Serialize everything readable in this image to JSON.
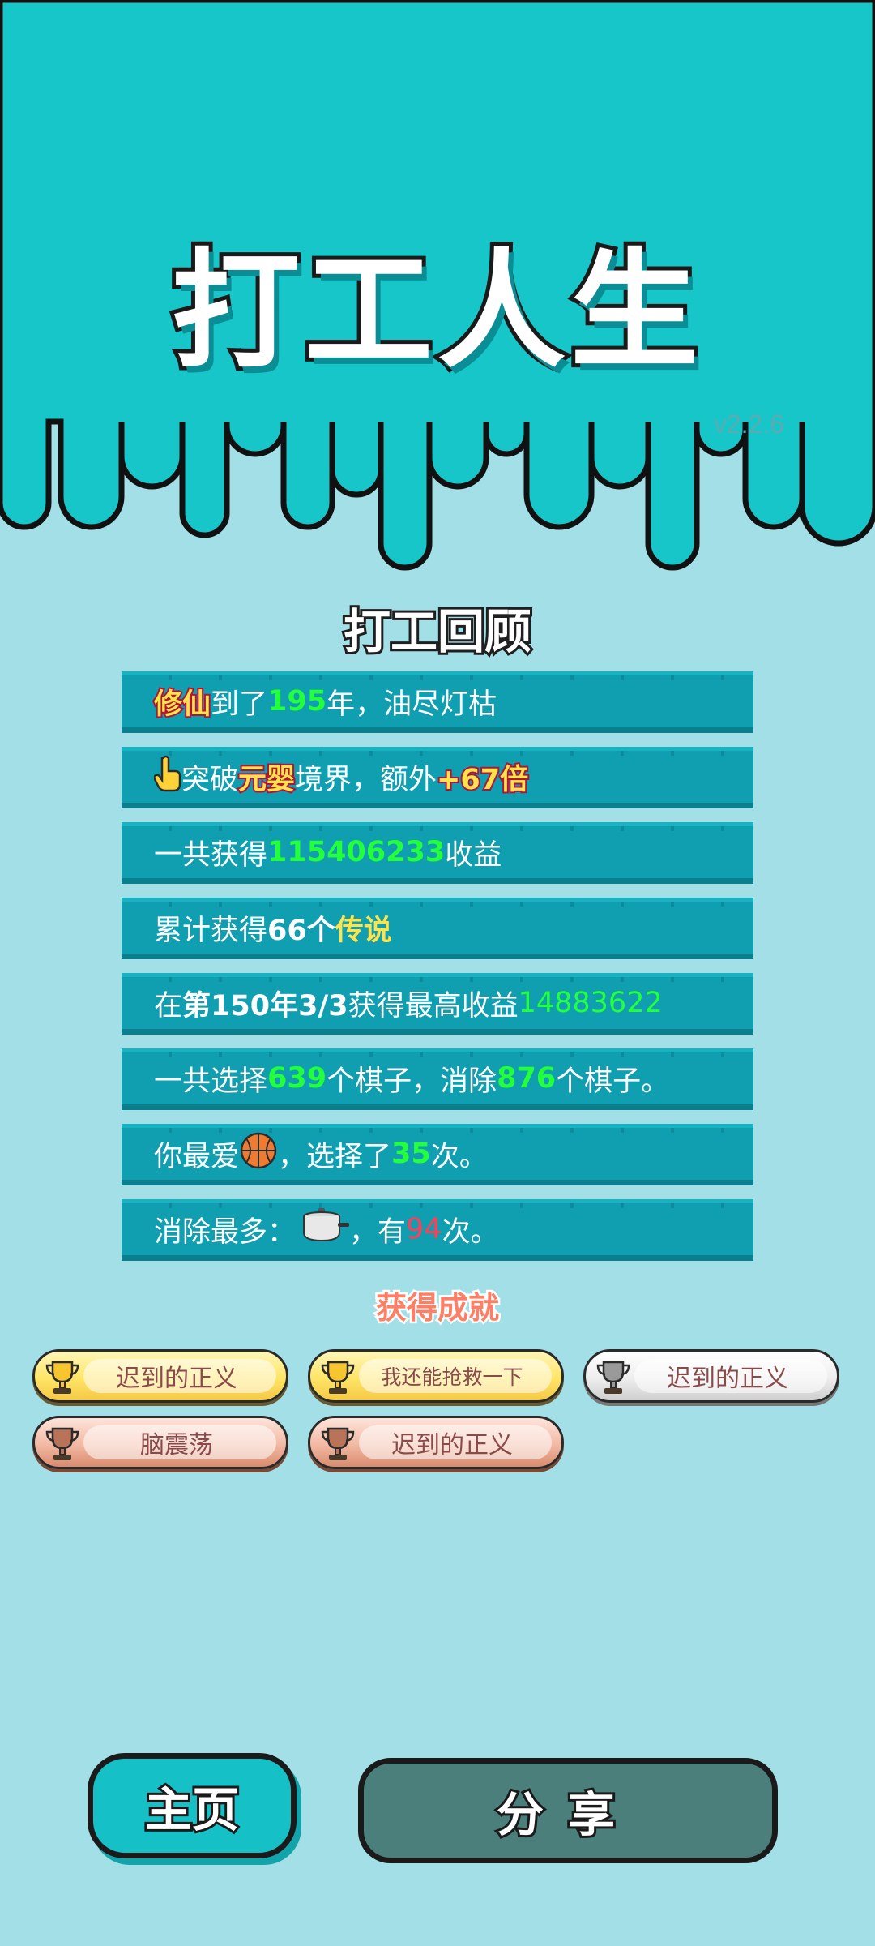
{
  "header": {
    "title": "打工人生",
    "version": "v2.2.6"
  },
  "review": {
    "title": "打工回顾",
    "rows": [
      {
        "parts": [
          {
            "t": "修仙",
            "c": "y"
          },
          {
            "t": "到了"
          },
          {
            "t": "195",
            "c": "g"
          },
          {
            "t": "年，油尽灯枯"
          }
        ]
      },
      {
        "icon": "pointing-hand-icon",
        "parts": [
          {
            "t": "突破"
          },
          {
            "t": "元婴",
            "c": "y"
          },
          {
            "t": "境界，额外"
          },
          {
            "t": "+67倍",
            "c": "y"
          }
        ]
      },
      {
        "parts": [
          {
            "t": "一共获得"
          },
          {
            "t": "115406233",
            "c": "g"
          },
          {
            "t": "收益"
          }
        ]
      },
      {
        "parts": [
          {
            "t": "累计获得"
          },
          {
            "t": "66个",
            "c": "b"
          },
          {
            "t": "传说",
            "c": "y2"
          }
        ]
      },
      {
        "parts": [
          {
            "t": "在 "
          },
          {
            "t": "第150年3/3",
            "c": "b"
          },
          {
            "t": " 获得最高收益"
          },
          {
            "t": "14883622",
            "c": "g2"
          }
        ]
      },
      {
        "parts": [
          {
            "t": "一共选择"
          },
          {
            "t": "639",
            "c": "g"
          },
          {
            "t": "个棋子，消除"
          },
          {
            "t": "876",
            "c": "g"
          },
          {
            "t": "个棋子。"
          }
        ]
      },
      {
        "parts": [
          {
            "t": "你最爱"
          },
          {
            "icon": "basketball-icon"
          },
          {
            "t": "，选择了"
          },
          {
            "t": "35",
            "c": "g"
          },
          {
            "t": "次。"
          }
        ]
      },
      {
        "parts": [
          {
            "t": "消除最多："
          },
          {
            "icon": "cooking-pot-icon"
          },
          {
            "t": "，有"
          },
          {
            "t": "94",
            "c": "r"
          },
          {
            "t": "次。"
          }
        ]
      }
    ]
  },
  "achievements": {
    "title": "获得成就",
    "items": [
      {
        "label": "迟到的正义",
        "tier": "gold"
      },
      {
        "label": "我还能抢救一下",
        "tier": "gold"
      },
      {
        "label": "迟到的正义",
        "tier": "silver"
      },
      {
        "label": "脑震荡",
        "tier": "bronze"
      },
      {
        "label": "迟到的正义",
        "tier": "bronze"
      }
    ]
  },
  "buttons": {
    "home": "主页",
    "share": "分享"
  },
  "colors": {
    "header_bg": "#17c6c9",
    "page_bg": "#a3dfe6",
    "row_bg": "#0f9fb0",
    "highlight_green": "#23ff3a",
    "highlight_yellow": "#ffe34a",
    "highlight_red": "#ff3f5a"
  }
}
